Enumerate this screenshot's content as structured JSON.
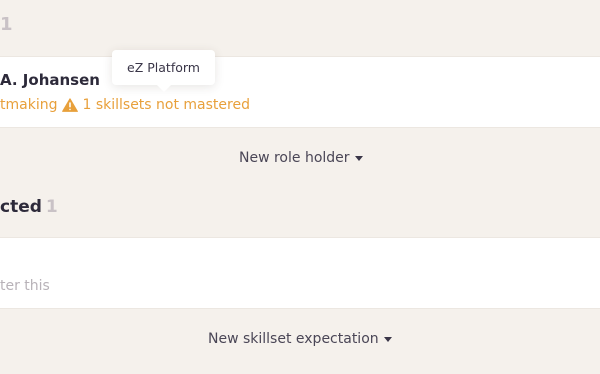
{
  "role_holders": {
    "count": "1",
    "holder": {
      "name": "A. Johansen",
      "skill_name": "tmaking",
      "warning_text": "1 skillsets not mastered"
    },
    "tooltip": "eZ Platform",
    "new_button_label": "New role holder"
  },
  "skillset_expectations": {
    "title": "cted",
    "count": "1",
    "placeholder": "ter this",
    "new_button_label": "New skillset expectation"
  },
  "colors": {
    "background": "#f5f1ec",
    "card": "#ffffff",
    "warning": "#e8a03b",
    "text": "#2d2a3a",
    "muted": "#c9c2c6"
  },
  "icons": {
    "warning": "warning-triangle-icon",
    "caret": "caret-down-icon"
  }
}
